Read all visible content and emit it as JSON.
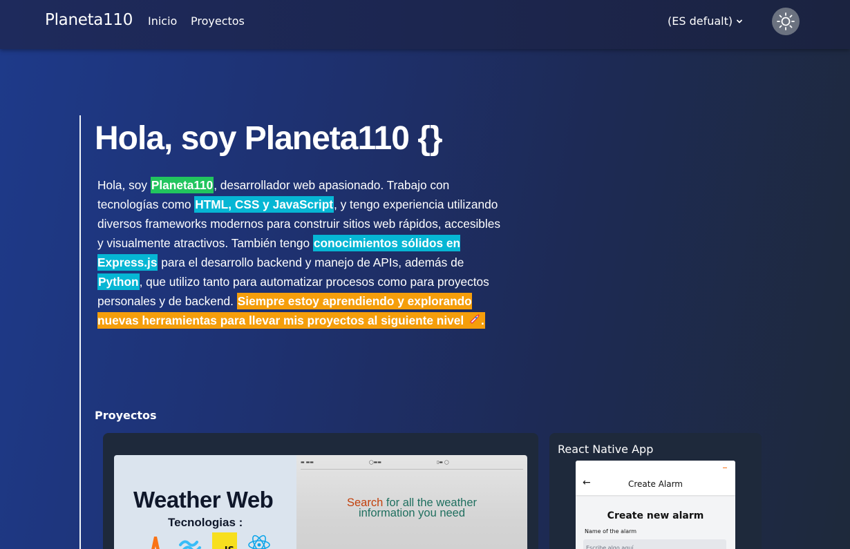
{
  "nav": {
    "brand": "Planeta110",
    "links": [
      "Inicio",
      "Proyectos"
    ],
    "language": "(ES defualt)",
    "theme_icon": "sun-icon"
  },
  "hero": {
    "title": "Hola, soy Planeta110 {}",
    "p1": "Hola, soy ",
    "h1": "Planeta110",
    "p2": ", desarrollador web apasionado. Trabajo con tecnologías como ",
    "h2": "HTML, CSS y JavaScript",
    "p3": ", y tengo experiencia utilizando diversos frameworks modernos para construir sitios web rápidos, accesibles y visualmente atractivos. También tengo ",
    "h3": "conocimientos sólidos en Express.js",
    "p4": " para el desarrollo backend y manejo de APIs, además de ",
    "h4": "Python",
    "p5": ", que utilizo tanto para automatizar procesos como para proyectos personales y de backend. ",
    "h5": "Siempre estoy aprendiendo y explorando nuevas herramientas para llevar mis proyectos al siguiente nivel",
    "h5_tail": "."
  },
  "projects": {
    "section_title": "Proyectos",
    "weather": {
      "title": "Weather Web",
      "subtitle": "Tecnologias :",
      "tech_icons": [
        "astro-icon",
        "tailwind-icon",
        "javascript-icon",
        "react-icon"
      ],
      "js_label": "JS",
      "search_prefix": "Search",
      "search_rest": " for all the weather",
      "search_line2": "information you need"
    },
    "react_native": {
      "title": "React Native App",
      "screen_header": "Create Alarm",
      "screen_title": "Create new alarm",
      "field_label": "Name of the alarm",
      "field_placeholder": "Escribe algo aquí"
    }
  },
  "colors": {
    "highlight_green": "#22c55e",
    "highlight_cyan": "#06b6d4",
    "highlight_orange": "#f59e0b",
    "card_bg": "#1e293b"
  }
}
